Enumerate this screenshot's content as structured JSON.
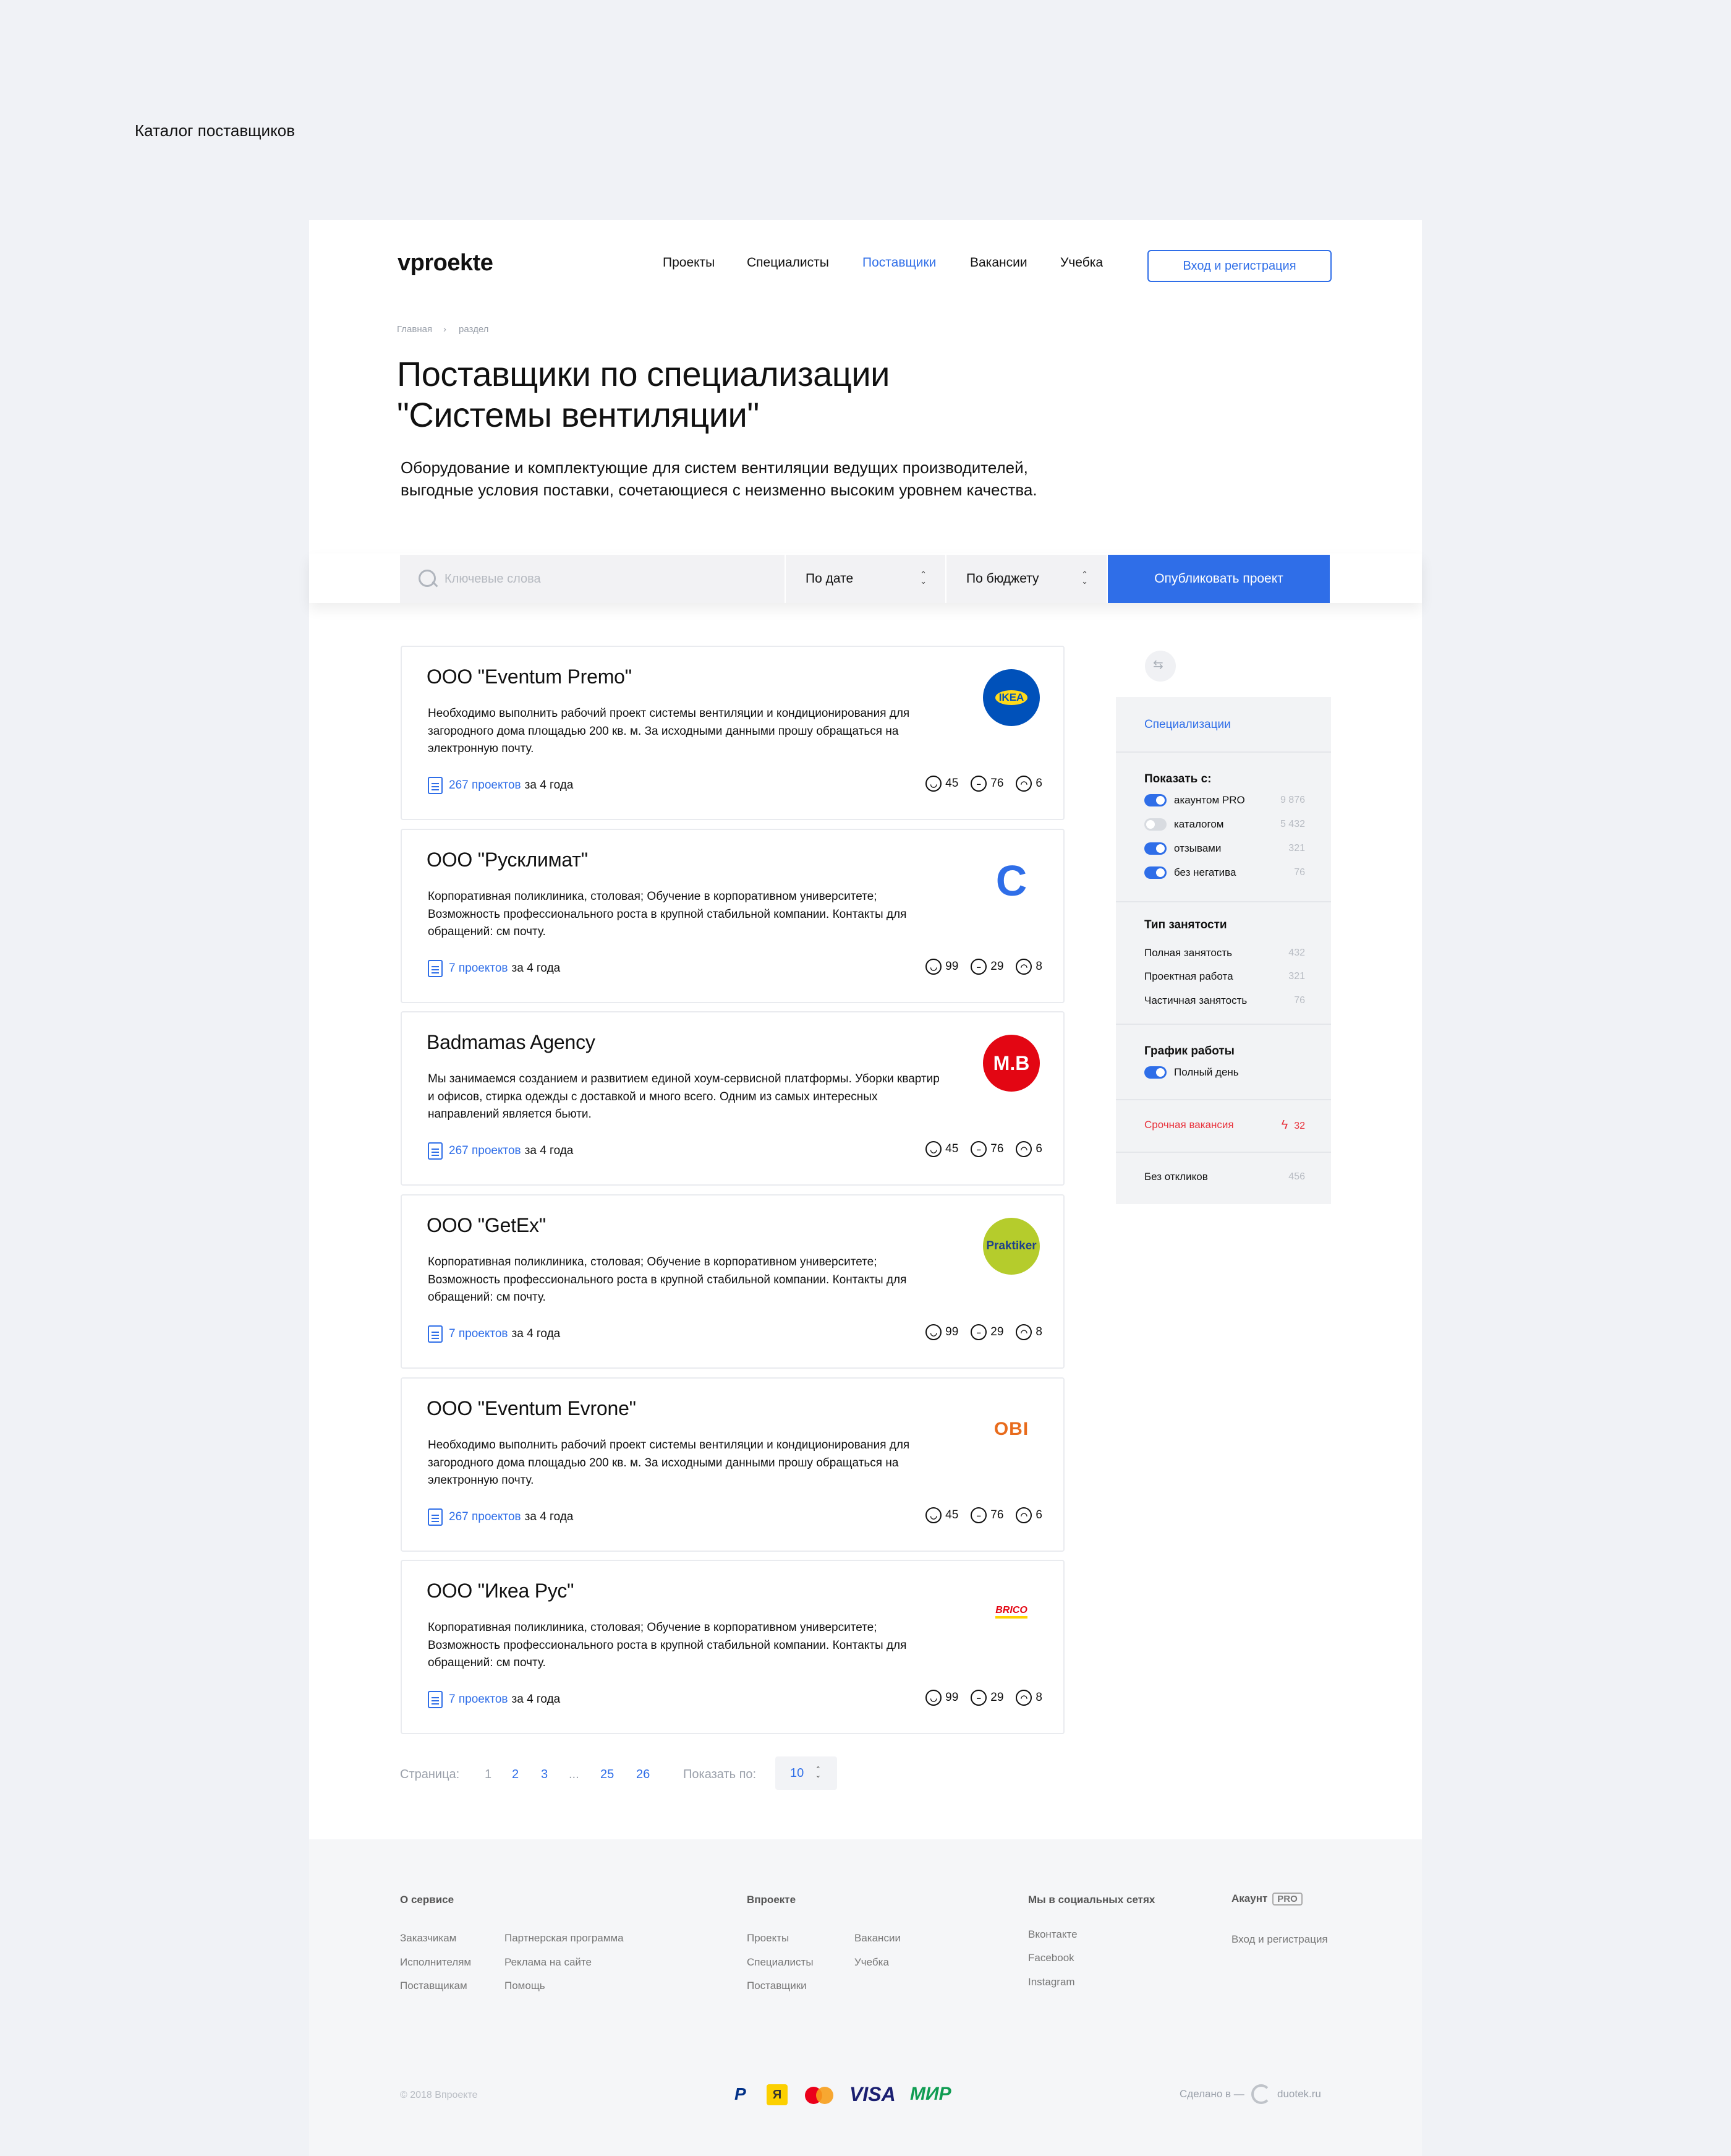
{
  "page_caption": "Каталог поставщиков",
  "header": {
    "logo": "vproekte",
    "nav": [
      "Проекты",
      "Специалисты",
      "Поставщики",
      "Вакансии",
      "Учебка"
    ],
    "active_nav": "Поставщики",
    "login_label": "Вход и регистрация"
  },
  "breadcrumb": {
    "home": "Главная",
    "section": "раздел"
  },
  "title_line1": "Поставщики по специализации",
  "title_line2": "\"Системы вентиляции\"",
  "lead": "Оборудование и комплектующие для систем вентиляции ведущих производителей, выгодные условия поставки, сочетающиеся с неизменно высоким уровнем качества.",
  "toolbar": {
    "search_placeholder": "Ключевые слова",
    "sort_date": "По дате",
    "sort_budget": "По бюджету",
    "publish_label": "Опубликовать проект"
  },
  "cards": [
    {
      "title": "ООО \"Eventum Premo\"",
      "desc": "Необходимо выполнить рабочий проект системы вентиляции и кондиционирования для загородного дома площадью 200 кв. м. За исходными данными прошу обращаться на электронную почту.",
      "projects": "267 проектов",
      "period": "за 4 года",
      "pos": "45",
      "neu": "76",
      "neg": "6",
      "logo_text": "IKEA",
      "logo_icon": "ikea-logo-icon"
    },
    {
      "title": "ООО \"Русклимат\"",
      "desc": "Корпоративная поликлиника, столовая; Обучение в корпоративном университете; Возможность профессионального роста в крупной стабильной компании. Контакты для обращений: см почту.",
      "projects": "7 проектов",
      "period": "за 4 года",
      "pos": "99",
      "neu": "29",
      "neg": "8",
      "logo_text": "C",
      "logo_icon": "rusklimat-logo-icon"
    },
    {
      "title": "Badmamas Agency",
      "desc": "Мы занимаемся созданием и развитием единой хоум-сервисной платформы. Уборки квартир и офисов, стирка одежды с доставкой и много всего. Одним из самых интересных направлений является бьюти.",
      "projects": "267 проектов",
      "period": "за 4 года",
      "pos": "45",
      "neu": "76",
      "neg": "6",
      "logo_text": "M.B",
      "logo_icon": "mvideo-logo-icon"
    },
    {
      "title": "ООО \"GetEx\"",
      "desc": "Корпоративная поликлиника, столовая; Обучение в корпоративном университете; Возможность профессионального роста в крупной стабильной компании. Контакты для обращений: см почту.",
      "projects": "7 проектов",
      "period": "за 4 года",
      "pos": "99",
      "neu": "29",
      "neg": "8",
      "logo_text": "Praktiker",
      "logo_icon": "praktiker-logo-icon"
    },
    {
      "title": "ООО \"Eventum Evrone\"",
      "desc": "Необходимо выполнить рабочий проект системы вентиляции и кондиционирования для загородного дома площадью 200 кв. м. За исходными данными прошу обращаться на электронную почту.",
      "projects": "267 проектов",
      "period": "за 4 года",
      "pos": "45",
      "neu": "76",
      "neg": "6",
      "logo_text": "OBI",
      "logo_icon": "obi-logo-icon"
    },
    {
      "title": "ООО \"Икеа Рус\"",
      "desc": "Корпоративная поликлиника, столовая; Обучение в корпоративном университете; Возможность профессионального роста в крупной стабильной компании. Контакты для обращений: см почту.",
      "projects": "7 проектов",
      "period": "за 4 года",
      "pos": "99",
      "neu": "29",
      "neg": "8",
      "logo_text": "BRICO",
      "logo_icon": "brico-logo-icon"
    }
  ],
  "pagination": {
    "label": "Страница:",
    "pages": [
      "1",
      "2",
      "3",
      "...",
      "25",
      "26"
    ],
    "current": "1",
    "per_page_label": "Показать по:",
    "per_page": "10"
  },
  "sidebar": {
    "specializations": "Специализации",
    "show_title": "Показать с:",
    "show_rows": [
      {
        "label": "акаунтом PRO",
        "count": "9 876",
        "on": true
      },
      {
        "label": "каталогом",
        "count": "5 432",
        "on": false
      },
      {
        "label": "отзывами",
        "count": "321",
        "on": true
      },
      {
        "label": "без негатива",
        "count": "76",
        "on": true
      }
    ],
    "employment_title": "Тип занятости",
    "employment_rows": [
      {
        "label": "Полная занятость",
        "count": "432"
      },
      {
        "label": "Проектная работа",
        "count": "321"
      },
      {
        "label": "Частичная занятость",
        "count": "76"
      }
    ],
    "schedule_title": "График работы",
    "schedule_row": "Полный день",
    "urgent_label": "Срочная вакансия",
    "urgent_count": "32",
    "no_replies_label": "Без откликов",
    "no_replies_count": "456"
  },
  "footer": {
    "about_title": "О сервисе",
    "about_col1": [
      "Заказчикам",
      "Исполнителям",
      "Поставщикам"
    ],
    "about_col2": [
      "Партнерская программа",
      "Реклама на сайте",
      "Помощь"
    ],
    "vproekte_title": "Впроекте",
    "vproekte_col1": [
      "Проекты",
      "Специалисты",
      "Поставщики"
    ],
    "vproekte_col2": [
      "Вакансии",
      "Учебка"
    ],
    "social_title": "Мы в социальных сетях",
    "social": [
      "Вконтакте",
      "Facebook",
      "Instagram"
    ],
    "account_title": "Акаунт",
    "account_badge": "PRO",
    "account_link": "Вход и регистрация",
    "copyright": "© 2018 Впроекте",
    "made_in": "Сделано в —",
    "studio": "duotek.ru",
    "payments": [
      "P",
      "Я",
      "mastercard",
      "VISA",
      "МИР"
    ]
  },
  "colors": {
    "accent": "#2f6ee8",
    "urgent": "#e8323c",
    "bg": "#f0f2f6"
  }
}
